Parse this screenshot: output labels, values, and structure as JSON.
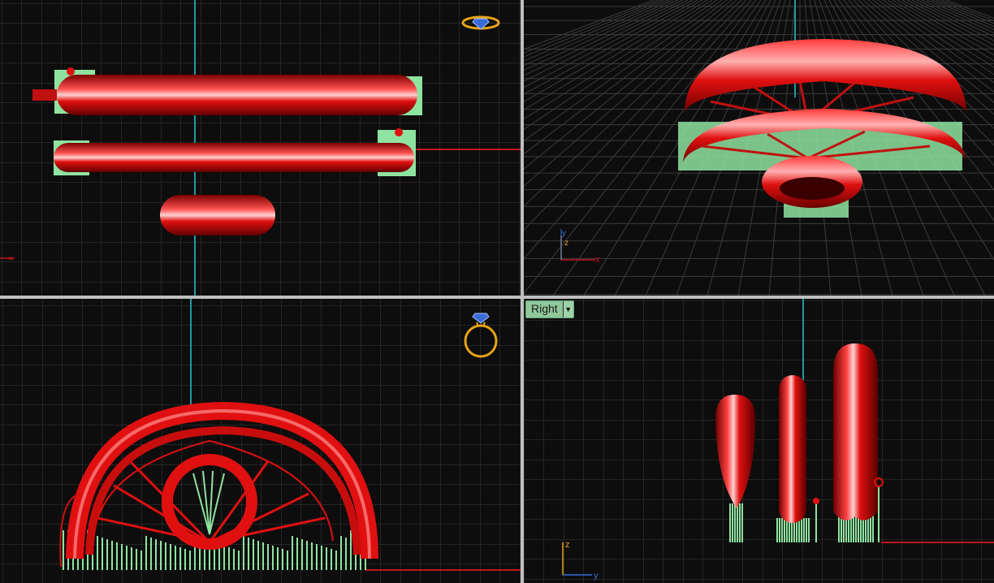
{
  "app": "3D modeling viewports (ring model)",
  "viewports": [
    {
      "id": "top",
      "label": "",
      "axes": {
        "x": "x",
        "y": ""
      }
    },
    {
      "id": "perspective",
      "label": "",
      "axes": {
        "x": "x",
        "y": "y",
        "z": "z"
      }
    },
    {
      "id": "front",
      "label": "",
      "axes": {}
    },
    {
      "id": "right",
      "label": "Right",
      "axes": {
        "z": "z",
        "y": "y"
      }
    }
  ],
  "colors": {
    "background": "#0d0d0d",
    "grid_minor": "#2c2c2c",
    "grid_major": "#4a4a4a",
    "x_axis": "#c01818",
    "y_axis": "#1e9aa6",
    "model": "#e01010",
    "supports": "#8fe3a0",
    "gizmo": "#e8a21a",
    "gizmo_gem": "#3a6cd8"
  },
  "icons": [
    "ring-gizmo-icon",
    "viewport-menu-arrow-icon"
  ]
}
